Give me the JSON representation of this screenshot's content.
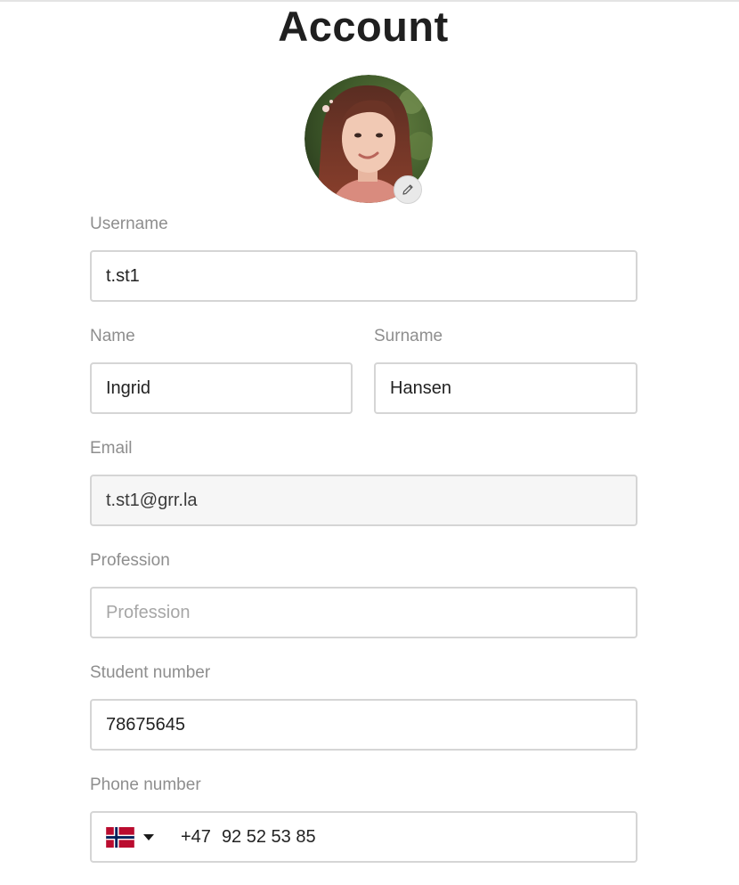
{
  "page": {
    "title": "Account"
  },
  "avatar": {
    "icon": "user-photo",
    "edit_icon": "pencil-icon"
  },
  "form": {
    "username": {
      "label": "Username",
      "value": "t.st1",
      "placeholder": ""
    },
    "name": {
      "label": "Name",
      "value": "Ingrid",
      "placeholder": ""
    },
    "surname": {
      "label": "Surname",
      "value": "Hansen",
      "placeholder": ""
    },
    "email": {
      "label": "Email",
      "value": "t.st1@grr.la",
      "placeholder": "",
      "disabled": true
    },
    "profession": {
      "label": "Profession",
      "value": "",
      "placeholder": "Profession"
    },
    "student_number": {
      "label": "Student number",
      "value": "78675645",
      "placeholder": ""
    },
    "phone": {
      "label": "Phone number",
      "country": "Norway",
      "flag_icon": "norway-flag-icon",
      "dial_code": "+47",
      "value": "92 52 53 85"
    }
  },
  "colors": {
    "label": "#8e8e8e",
    "border": "#d5d5d5",
    "disabled_bg": "#f6f6f6",
    "text": "#222222"
  }
}
